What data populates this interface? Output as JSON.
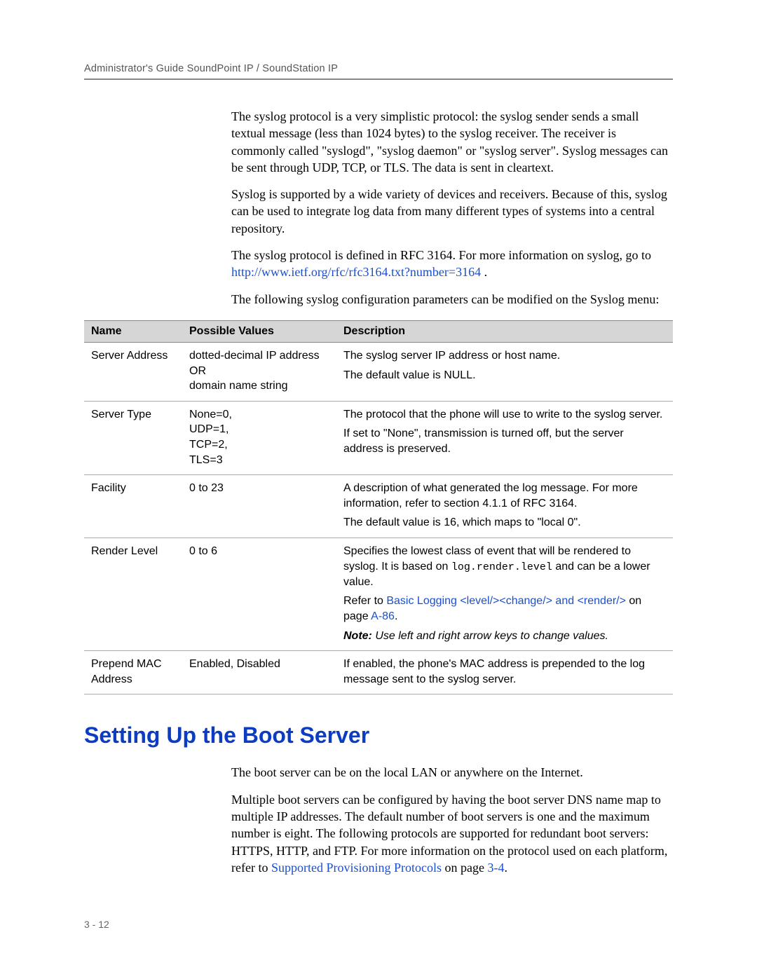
{
  "header": {
    "running": "Administrator's Guide SoundPoint IP / SoundStation IP"
  },
  "intro": {
    "p1": "The syslog protocol is a very simplistic protocol: the syslog sender sends a small textual message (less than 1024 bytes) to the syslog receiver. The receiver is commonly called \"syslogd\", \"syslog daemon\" or \"syslog server\". Syslog messages can be sent through UDP, TCP, or TLS. The data is sent in cleartext.",
    "p2": "Syslog is supported by a wide variety of devices and receivers. Because of this, syslog can be used to integrate log data from many different types of systems into a central repository.",
    "p3a": "The syslog protocol is defined in RFC 3164. For more information on syslog, go to ",
    "p3_link": "http://www.ietf.org/rfc/rfc3164.txt?number=3164",
    "p3b": " .",
    "p4": "The following syslog configuration parameters can be modified on the Syslog menu:"
  },
  "table": {
    "headers": {
      "name": "Name",
      "vals": "Possible Values",
      "desc": "Description"
    },
    "rows": [
      {
        "name": "Server Address",
        "vals": [
          "dotted-decimal IP address",
          "OR",
          "domain name string"
        ],
        "desc": [
          "The syslog server IP address or host name.",
          "The default value is NULL."
        ]
      },
      {
        "name": "Server Type",
        "vals": [
          "None=0,",
          "UDP=1,",
          "TCP=2,",
          "TLS=3"
        ],
        "desc": [
          "The protocol that the phone will use to write to the syslog server.",
          "If set to \"None\", transmission is turned off, but the server address is preserved."
        ]
      },
      {
        "name": "Facility",
        "vals": [
          "0 to 23"
        ],
        "desc": [
          "A description of what generated the log message. For more information, refer to section 4.1.1 of RFC 3164.",
          "The default value is 16, which maps to \"local 0\"."
        ]
      },
      {
        "name": "Render Level",
        "vals": [
          "0 to 6"
        ],
        "desc_parts": {
          "p1a": "Specifies the lowest class of event that will be rendered to syslog. It is based on ",
          "p1_mono": "log.render.level",
          "p1b": " and can be a lower value.",
          "p2a": "Refer to ",
          "p2_link": "Basic Logging <level/><change/> and <render/>",
          "p2b": " on page ",
          "p2_link2": "A-86",
          "p2c": ".",
          "note_label": "Note:",
          "note_text": " Use left and right arrow keys to change values."
        }
      },
      {
        "name": "Prepend MAC Address",
        "vals": [
          "Enabled, Disabled"
        ],
        "desc": [
          "If enabled, the phone's MAC address is prepended to the log message sent to the syslog server."
        ]
      }
    ]
  },
  "section2": {
    "heading": "Setting Up the Boot Server",
    "p1": "The boot server can be on the local LAN or anywhere on the Internet.",
    "p2a": "Multiple boot servers can be configured by having the boot server DNS name map to multiple IP addresses. The default number of boot servers is one and the maximum number is eight. The following protocols are supported for redundant boot servers: HTTPS, HTTP, and FTP. For more information on the protocol used on each platform, refer to ",
    "p2_link": "Supported Provisioning Protocols",
    "p2b": " on page ",
    "p2_link2": "3-4",
    "p2c": "."
  },
  "page_number": "3 - 12"
}
